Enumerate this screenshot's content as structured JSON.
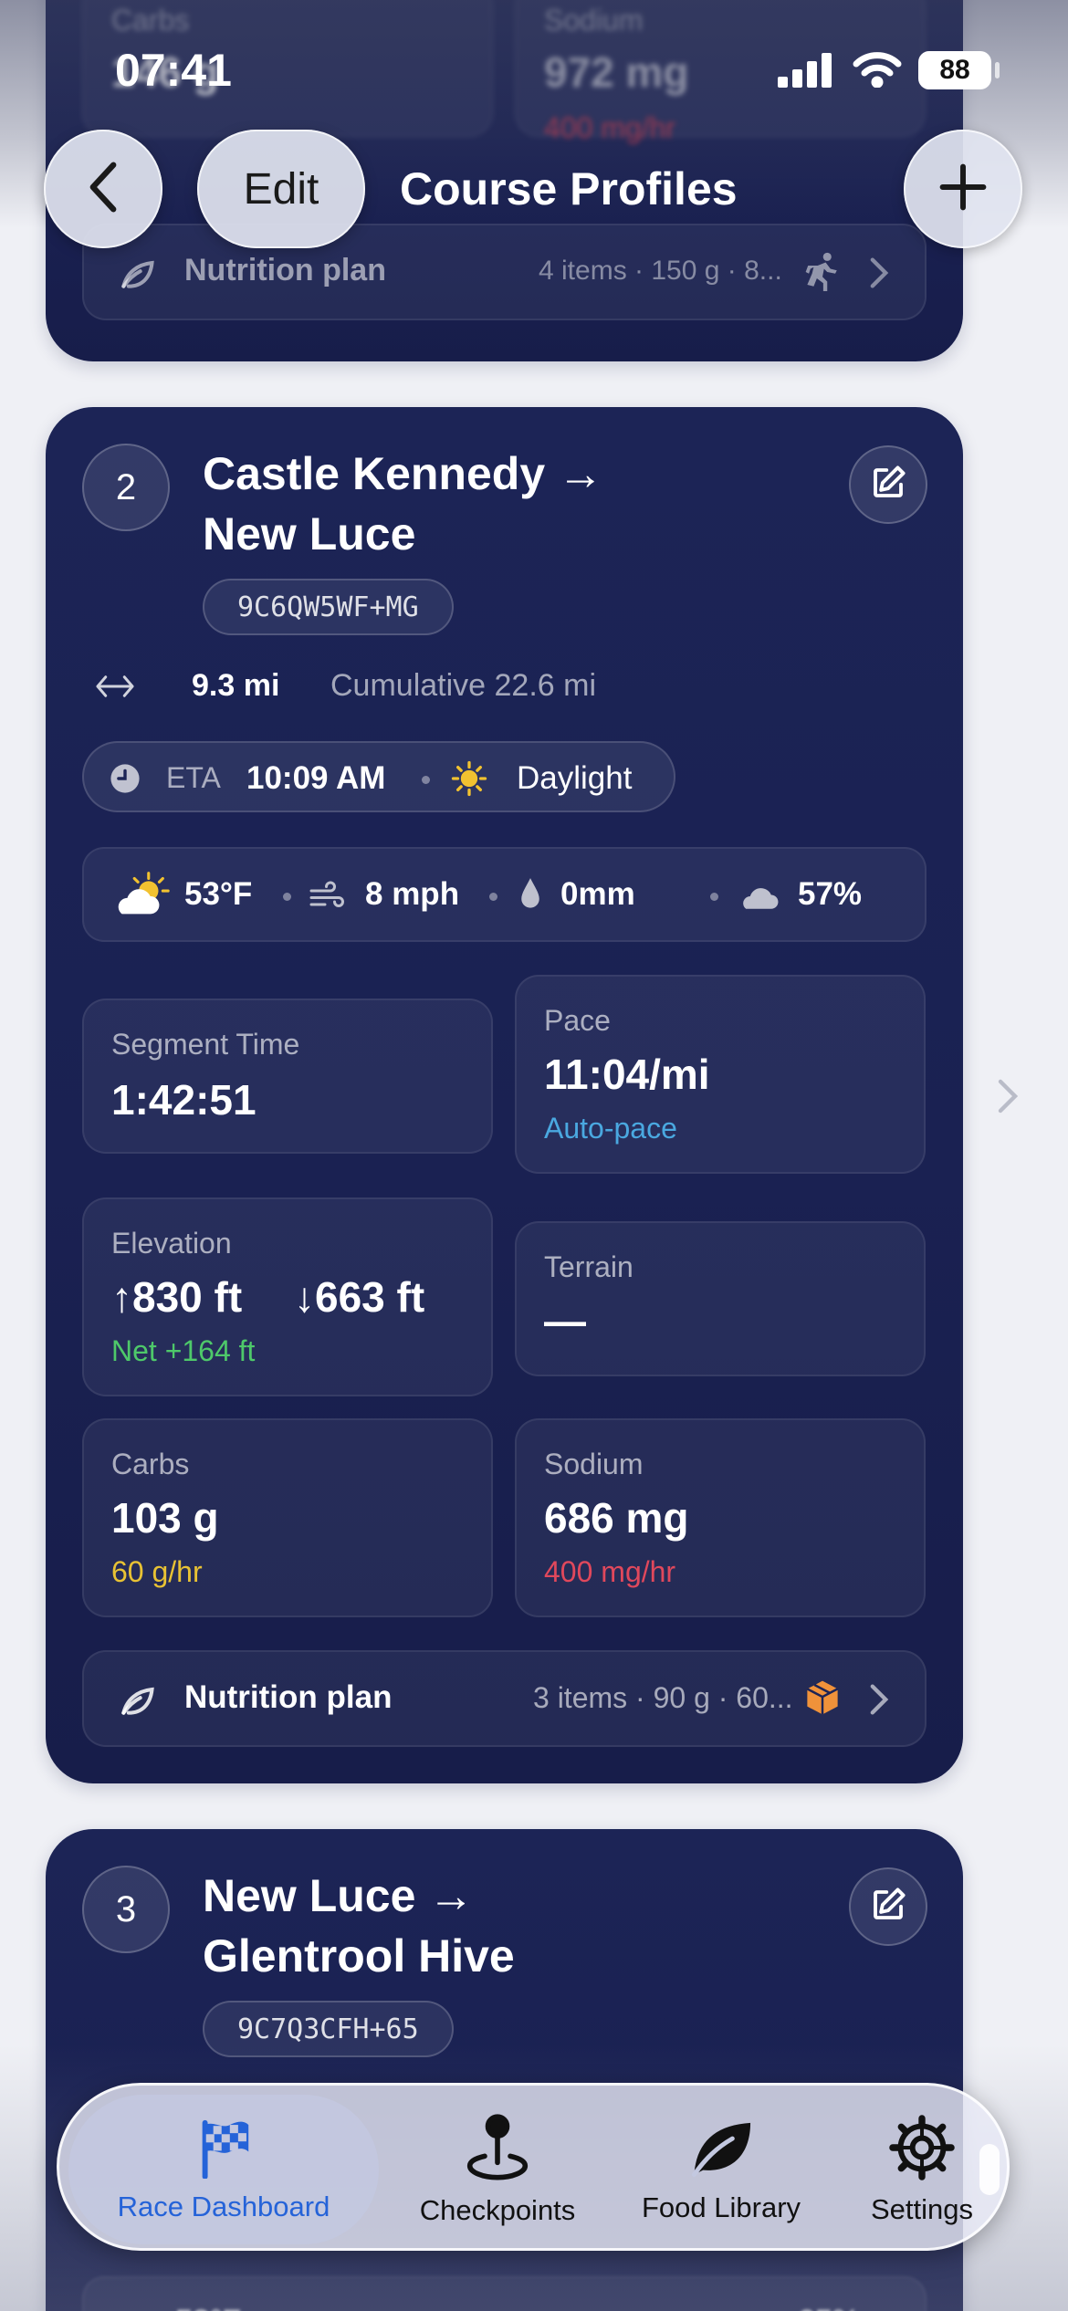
{
  "status_bar": {
    "time": "07:41",
    "battery": "88"
  },
  "nav": {
    "edit_label": "Edit",
    "title": "Course Profiles"
  },
  "segment1": {
    "carbs_label": "Carbs",
    "carbs_value": "146 g",
    "sodium_label": "Sodium",
    "sodium_value": "972 mg",
    "sodium_rate": "400 mg/hr",
    "nutrition_label": "Nutrition plan",
    "nutrition_summary": "4 items · 150 g · 8..."
  },
  "segment2": {
    "number": "2",
    "title_line1": "Castle Kennedy →",
    "title_line2": "New Luce",
    "plus_code": "9C6QW5WF+MG",
    "distance": "9.3 mi",
    "cumulative": "Cumulative 22.6 mi",
    "eta_label": "ETA",
    "eta_time": "10:09 AM",
    "light": "Daylight",
    "weather": {
      "temp": "53°F",
      "wind": "8 mph",
      "precip": "0mm",
      "cloud": "57%"
    },
    "segment_time_label": "Segment Time",
    "segment_time": "1:42:51",
    "pace_label": "Pace",
    "pace": "11:04/mi",
    "pace_mode": "Auto-pace",
    "elevation_label": "Elevation",
    "elev_up": "↑830 ft",
    "elev_down": "↓663 ft",
    "elev_net": "Net +164 ft",
    "terrain_label": "Terrain",
    "terrain": "—",
    "carbs_label": "Carbs",
    "carbs": "103 g",
    "carbs_rate": "60 g/hr",
    "sodium_label": "Sodium",
    "sodium": "686 mg",
    "sodium_rate": "400 mg/hr",
    "nutrition_label": "Nutrition plan",
    "nutrition_summary": "3 items · 90 g · 60..."
  },
  "segment3": {
    "number": "3",
    "title_line1": "New Luce →",
    "title_line2": "Glentrool Hive",
    "plus_code": "9C7Q3CFH+65",
    "weather": {
      "temp": "53°F",
      "cloud": "65%"
    }
  },
  "tabs": [
    {
      "label": "Race Dashboard",
      "icon": "checkered-flag-icon",
      "active": true
    },
    {
      "label": "Checkpoints",
      "icon": "map-pin-icon",
      "active": false
    },
    {
      "label": "Food Library",
      "icon": "leaf-icon",
      "active": false
    },
    {
      "label": "Settings",
      "icon": "gear-icon",
      "active": false
    }
  ],
  "colors": {
    "card": "#1a2152",
    "accent_blue": "#4aa8e0",
    "green": "#4ec96a",
    "yellow": "#e8c234",
    "red": "#e0485c",
    "tab_active": "#2563d8"
  }
}
